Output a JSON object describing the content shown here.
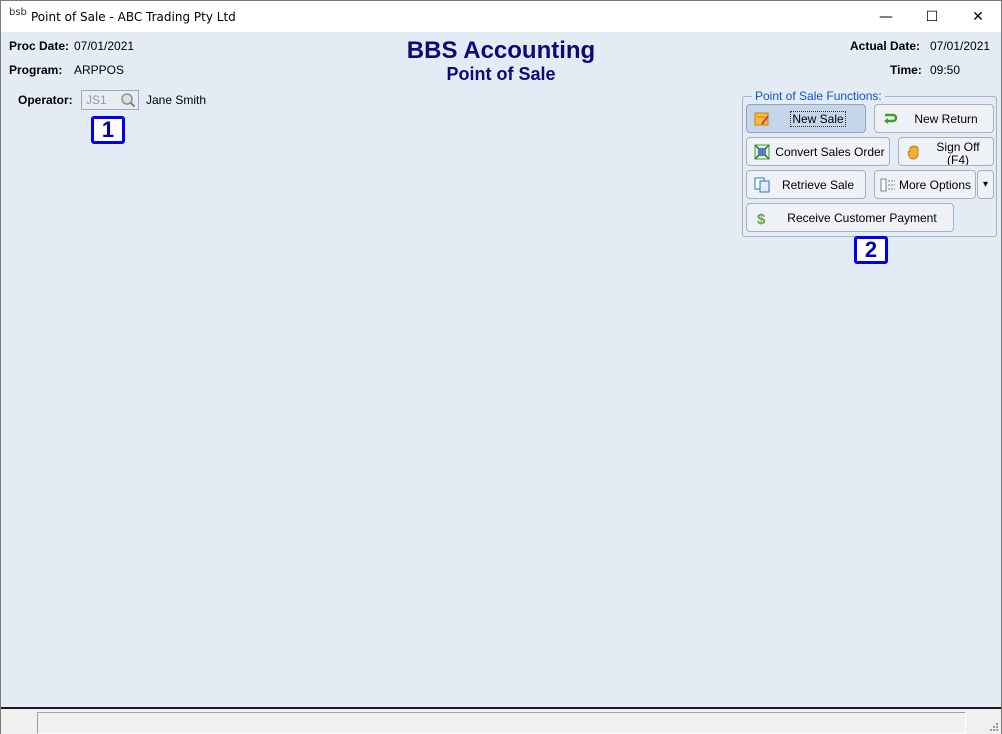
{
  "window": {
    "title": "Point of Sale - ABC Trading Pty Ltd",
    "app_icon_glyph": "bsb",
    "minimize_glyph": "—",
    "maximize_glyph": "☐",
    "close_glyph": "✕"
  },
  "header": {
    "proc_date_label": "Proc Date:",
    "proc_date_value": "07/01/2021",
    "program_label": "Program:",
    "program_value": "ARPPOS",
    "title": "BBS Accounting",
    "subtitle": "Point of Sale",
    "actual_date_label": "Actual Date:",
    "actual_date_value": "07/01/2021",
    "time_label": "Time:",
    "time_value": "09:50"
  },
  "operator": {
    "label": "Operator:",
    "code": "JS1",
    "name": "Jane Smith"
  },
  "markers": {
    "m1": "1",
    "m2": "2"
  },
  "functions": {
    "legend": "Point of Sale Functions:",
    "new_sale": "New Sale",
    "new_return": "New Return",
    "convert_sales_order": "Convert Sales Order",
    "sign_off_line1": "Sign Off",
    "sign_off_line2": "(F4)",
    "retrieve_sale": "Retrieve Sale",
    "more_options": "More Options",
    "more_options_arrow": "▾",
    "receive_payment": "Receive Customer Payment"
  },
  "colors": {
    "background": "#e3ebf5",
    "title_color": "#0a0a78",
    "legend_color": "#1450c8",
    "marker_color": "#0000f0"
  }
}
